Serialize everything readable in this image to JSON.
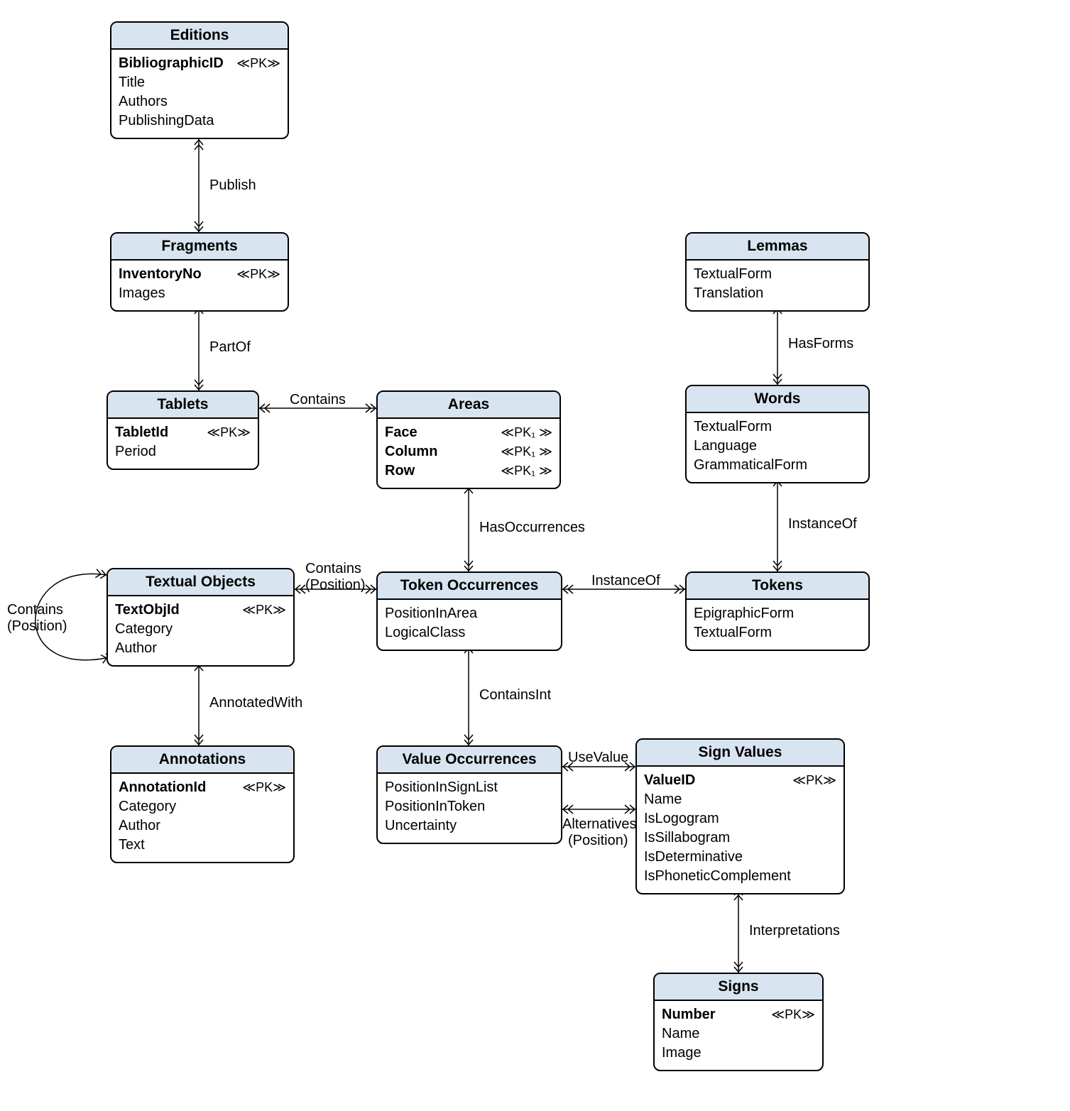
{
  "entities": {
    "editions": {
      "title": "Editions",
      "attrs": [
        {
          "name": "BibliographicID",
          "pk": "≪PK≫"
        },
        {
          "name": "Title"
        },
        {
          "name": "Authors"
        },
        {
          "name": "PublishingData"
        }
      ]
    },
    "fragments": {
      "title": "Fragments",
      "attrs": [
        {
          "name": "InventoryNo",
          "pk": "≪PK≫"
        },
        {
          "name": "Images"
        }
      ]
    },
    "tablets": {
      "title": "Tablets",
      "attrs": [
        {
          "name": "TabletId",
          "pk": "≪PK≫"
        },
        {
          "name": "Period"
        }
      ]
    },
    "areas": {
      "title": "Areas",
      "attrs": [
        {
          "name": "Face",
          "pk": "≪PK₁ ≫"
        },
        {
          "name": "Column",
          "pk": "≪PK₁ ≫"
        },
        {
          "name": "Row",
          "pk": "≪PK₁ ≫"
        }
      ]
    },
    "lemmas": {
      "title": "Lemmas",
      "attrs": [
        {
          "name": "TextualForm"
        },
        {
          "name": "Translation"
        }
      ]
    },
    "words": {
      "title": "Words",
      "attrs": [
        {
          "name": "TextualForm"
        },
        {
          "name": "Language"
        },
        {
          "name": "GrammaticalForm"
        }
      ]
    },
    "textualObjects": {
      "title": "Textual Objects",
      "attrs": [
        {
          "name": "TextObjId",
          "pk": "≪PK≫"
        },
        {
          "name": "Category"
        },
        {
          "name": "Author"
        }
      ]
    },
    "tokenOccurrences": {
      "title": "Token Occurrences",
      "attrs": [
        {
          "name": "PositionInArea"
        },
        {
          "name": "LogicalClass"
        }
      ]
    },
    "tokens": {
      "title": "Tokens",
      "attrs": [
        {
          "name": "EpigraphicForm"
        },
        {
          "name": "TextualForm"
        }
      ]
    },
    "annotations": {
      "title": "Annotations",
      "attrs": [
        {
          "name": "AnnotationId",
          "pk": "≪PK≫"
        },
        {
          "name": "Category"
        },
        {
          "name": "Author"
        },
        {
          "name": "Text"
        }
      ]
    },
    "valueOccurrences": {
      "title": "Value Occurrences",
      "attrs": [
        {
          "name": "PositionInSignList"
        },
        {
          "name": "PositionInToken"
        },
        {
          "name": "Uncertainty"
        }
      ]
    },
    "signValues": {
      "title": "Sign Values",
      "attrs": [
        {
          "name": "ValueID",
          "pk": "≪PK≫"
        },
        {
          "name": "Name"
        },
        {
          "name": "IsLogogram"
        },
        {
          "name": "IsSillabogram"
        },
        {
          "name": "IsDeterminative"
        },
        {
          "name": "IsPhoneticComplement"
        }
      ]
    },
    "signs": {
      "title": "Signs",
      "attrs": [
        {
          "name": "Number",
          "pk": "≪PK≫"
        },
        {
          "name": "Name"
        },
        {
          "name": "Image"
        }
      ]
    }
  },
  "labels": {
    "publish": "Publish",
    "partof": "PartOf",
    "contains1": "Contains",
    "hasoccurrences": "HasOccurrences",
    "hasforms": "HasForms",
    "instanceof1": "InstanceOf",
    "containsPos1a": "Contains",
    "containsPos1b": "(Position)",
    "instanceof2": "InstanceOf",
    "annotatedwith": "AnnotatedWith",
    "containsint": "ContainsInt",
    "usevalue": "UseValue",
    "alternatives1": "Alternatives",
    "alternatives2": "(Position)",
    "interpretations": "Interpretations",
    "selfContains1": "Contains",
    "selfContains2": "(Position)"
  }
}
